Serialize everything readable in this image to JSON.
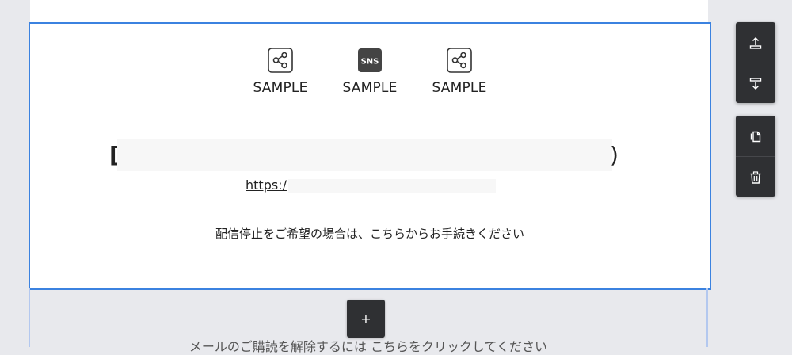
{
  "social_links": [
    {
      "label": "SAMPLE",
      "icon": "share-icon"
    },
    {
      "label": "SAMPLE",
      "icon": "sns-icon",
      "icon_text": "SNS"
    },
    {
      "label": "SAMPLE",
      "icon": "share-icon"
    }
  ],
  "footer": {
    "bracket_open": "[",
    "bracket_close": ")",
    "url_prefix": "https:/",
    "unsubscribe_text": "配信停止をご希望の場合は、",
    "unsubscribe_link": "こちらからお手続きください"
  },
  "lower_block": {
    "text": "メールのご購読を解除するには こちらをクリックしてください"
  },
  "add_button": {
    "label": "+"
  },
  "toolbar": {
    "top": [
      "move-up-icon",
      "move-down-icon"
    ],
    "bottom": [
      "copy-icon",
      "trash-icon"
    ]
  },
  "colors": {
    "selection_border": "#3b82e0",
    "toolbar_bg": "#2f3033",
    "canvas_bg": "#e8e9ed"
  }
}
